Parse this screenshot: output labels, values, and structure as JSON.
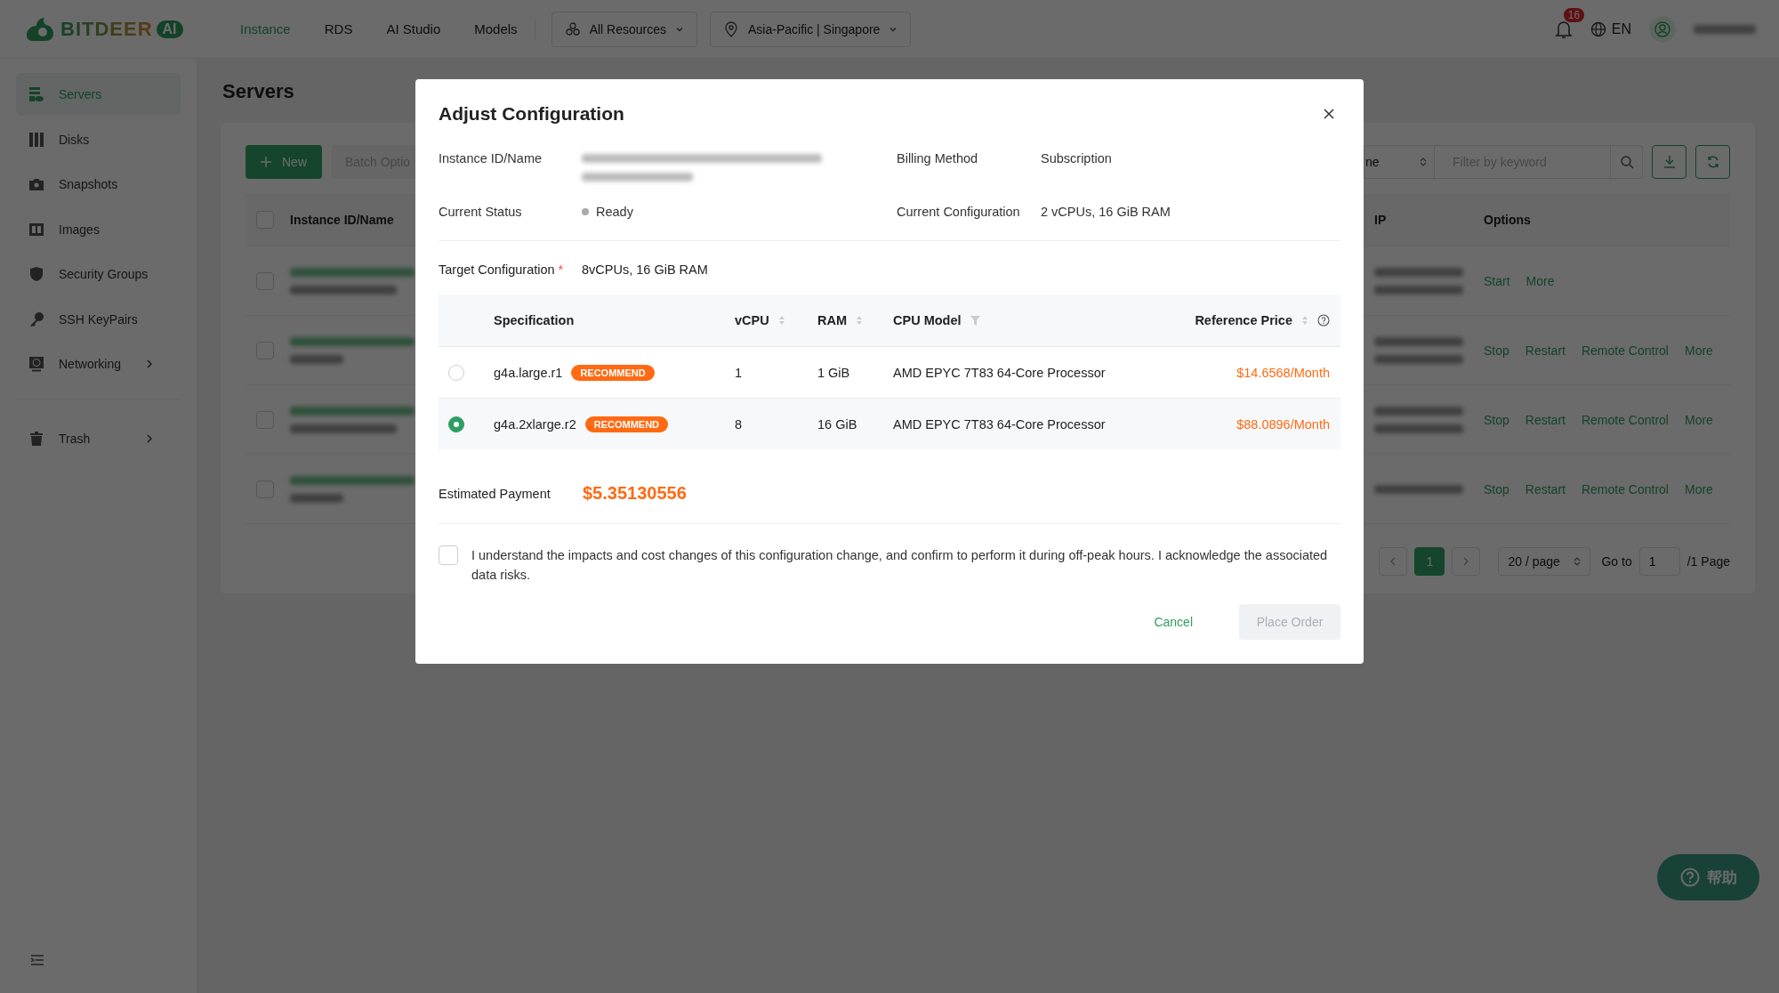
{
  "topbar": {
    "logo": {
      "text": "BITDEER",
      "badge": "AI"
    },
    "nav": [
      {
        "label": "Instance",
        "selected": true
      },
      {
        "label": "RDS",
        "selected": false
      },
      {
        "label": "AI Studio",
        "selected": false
      },
      {
        "label": "Models",
        "selected": false
      }
    ],
    "dropdowns": [
      {
        "kind": "resources",
        "label": "All Resources"
      },
      {
        "kind": "location",
        "label": "Asia-Pacific | Singapore"
      }
    ],
    "notification_count": "16",
    "language": "EN"
  },
  "sidebar": {
    "items": [
      {
        "kind": "servers",
        "label": "Servers",
        "selected": true,
        "expandable": false
      },
      {
        "kind": "disks",
        "label": "Disks",
        "selected": false,
        "expandable": false
      },
      {
        "kind": "snapshots",
        "label": "Snapshots",
        "selected": false,
        "expandable": false
      },
      {
        "kind": "images",
        "label": "Images",
        "selected": false,
        "expandable": false
      },
      {
        "kind": "security",
        "label": "Security Groups",
        "selected": false,
        "expandable": false
      },
      {
        "kind": "keys",
        "label": "SSH KeyPairs",
        "selected": false,
        "expandable": false
      },
      {
        "kind": "networking",
        "label": "Networking",
        "selected": false,
        "expandable": true
      }
    ],
    "bottom_items": [
      {
        "kind": "trash",
        "label": "Trash",
        "selected": false,
        "expandable": true
      }
    ]
  },
  "page": {
    "title": "Servers",
    "toolbar": {
      "new_button": "New",
      "batch_button": "Batch Optio",
      "select_value": "ne",
      "filter_placeholder": "Filter by keyword"
    },
    "table": {
      "header_checked": false,
      "columns": [
        "Instance ID/Name",
        "IP",
        "Options"
      ],
      "rows": [
        {
          "checked": false,
          "actions": [
            "Start",
            "More"
          ]
        },
        {
          "checked": false,
          "actions": [
            "Stop",
            "Restart",
            "Remote Control",
            "More"
          ]
        },
        {
          "checked": false,
          "actions": [
            "Stop",
            "Restart",
            "Remote Control",
            "More"
          ]
        },
        {
          "checked": false,
          "actions": [
            "Stop",
            "Restart",
            "Remote Control",
            "More"
          ]
        }
      ]
    },
    "pagination": {
      "current_page": "1",
      "page_size": "20 / page",
      "goto_label": "Go to",
      "goto_value": "1",
      "total": "/1 Page"
    }
  },
  "dialog": {
    "title": "Adjust Configuration",
    "info": [
      {
        "kind": "blurred",
        "label": "Instance ID/Name"
      },
      {
        "kind": "text",
        "label": "Billing Method",
        "value": "Subscription"
      },
      {
        "kind": "status",
        "label": "Current Status",
        "value": "Ready"
      },
      {
        "kind": "text",
        "label": "Current Configuration",
        "value": "2 vCPUs, 16 GiB RAM"
      }
    ],
    "target": {
      "label": "Target Configuration",
      "required_mark": "*",
      "value": "8vCPUs, 16 GiB RAM"
    },
    "table": {
      "columns": [
        {
          "label": "Specification",
          "sortable": false,
          "filter": false,
          "help": false
        },
        {
          "label": "vCPU",
          "sortable": true,
          "filter": false,
          "help": false
        },
        {
          "label": "RAM",
          "sortable": true,
          "filter": false,
          "help": false
        },
        {
          "label": "CPU Model",
          "sortable": false,
          "filter": true,
          "help": false
        },
        {
          "label": "Reference Price",
          "sortable": true,
          "filter": false,
          "help": true
        }
      ],
      "rows": [
        {
          "selected": false,
          "spec": "g4a.large.r1",
          "badge": "RECOMMEND",
          "vcpu": "1",
          "ram": "1 GiB",
          "cpu_model": "AMD EPYC 7T83 64-Core Processor",
          "price": "$14.6568/Month"
        },
        {
          "selected": true,
          "spec": "g4a.2xlarge.r2",
          "badge": "RECOMMEND",
          "vcpu": "8",
          "ram": "16 GiB",
          "cpu_model": "AMD EPYC 7T83 64-Core Processor",
          "price": "$88.0896/Month"
        }
      ]
    },
    "estimate": {
      "label": "Estimated Payment",
      "value": "$5.35130556"
    },
    "agreement": {
      "checked": false,
      "text": "I understand the impacts and cost changes of this configuration change, and confirm to perform it during off-peak hours. I acknowledge the associated data risks."
    },
    "buttons": [
      {
        "kind": "text",
        "label": "Cancel",
        "disabled": false
      },
      {
        "kind": "primary",
        "label": "Place Order",
        "disabled": true
      }
    ]
  },
  "help_button": {
    "label": "帮助"
  }
}
